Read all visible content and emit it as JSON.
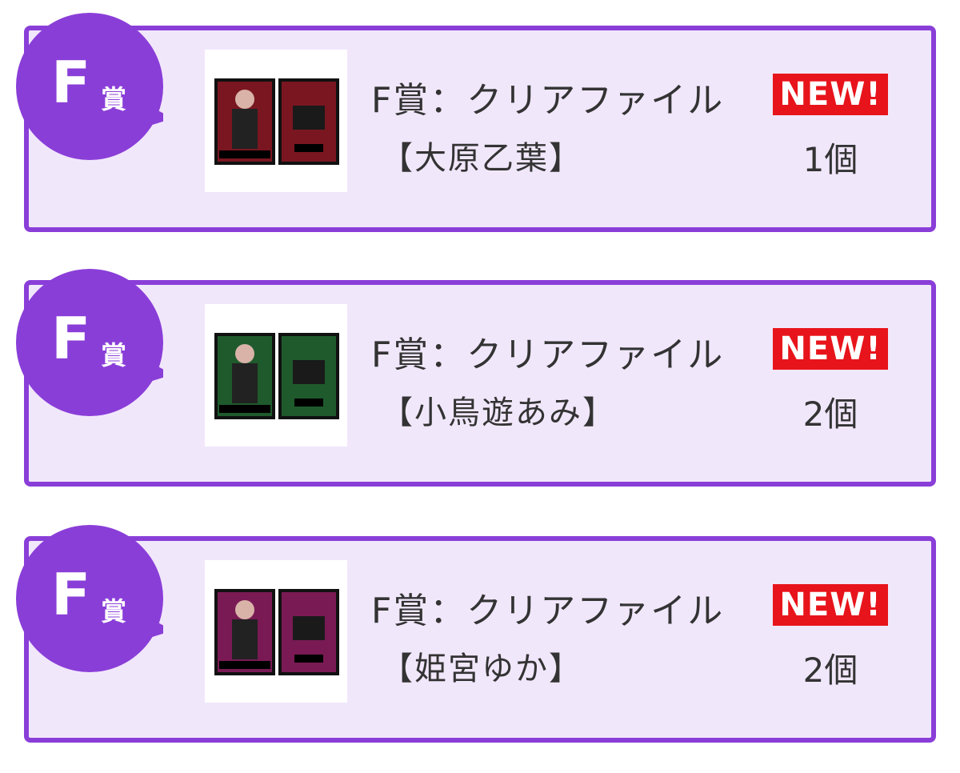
{
  "colors": {
    "accent": "#8a3ed8",
    "card_background": "#f1e7fb",
    "new_badge": "#e8141b",
    "text": "#333333"
  },
  "prizes": [
    {
      "badge_letter": "F",
      "badge_suffix": "賞",
      "title": "F賞：クリアファイル",
      "member": "【大原乙葉】",
      "new_label": "NEW!",
      "count": "1個",
      "thumbnail_icon": "clear-file-image",
      "file_color": "#7a1620"
    },
    {
      "badge_letter": "F",
      "badge_suffix": "賞",
      "title": "F賞：クリアファイル",
      "member": "【小鳥遊あみ】",
      "new_label": "NEW!",
      "count": "2個",
      "thumbnail_icon": "clear-file-image",
      "file_color": "#1f5a2c"
    },
    {
      "badge_letter": "F",
      "badge_suffix": "賞",
      "title": "F賞：クリアファイル",
      "member": "【姫宮ゆか】",
      "new_label": "NEW!",
      "count": "2個",
      "thumbnail_icon": "clear-file-image",
      "file_color": "#7a1a55"
    }
  ]
}
